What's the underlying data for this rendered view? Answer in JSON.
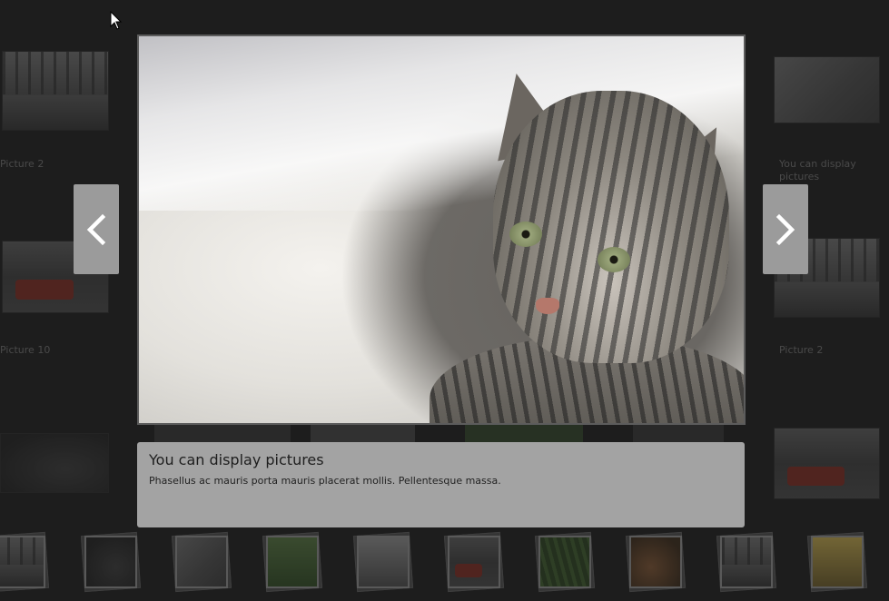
{
  "background_gallery": {
    "left_captions": [
      "Picture 2",
      "Picture 10"
    ],
    "right_captions": [
      "You can display pictures",
      "Picture 2"
    ]
  },
  "lightbox": {
    "caption_title": "You can display pictures",
    "caption_text": "Phasellus ac mauris porta mauris placerat mollis. Pellentesque massa.",
    "prev_icon": "chevron-left-icon",
    "next_icon": "chevron-right-icon"
  },
  "filmstrip": {
    "items": [
      "forest-road",
      "tent",
      "cat",
      "pond",
      "people",
      "fire-truck",
      "grass",
      "barrels",
      "forest-road",
      "sign"
    ]
  },
  "colors": {
    "backdrop": "#1d1d1d",
    "nav_button": "#9b9b9b",
    "caption_box": "#a3a3a3"
  }
}
